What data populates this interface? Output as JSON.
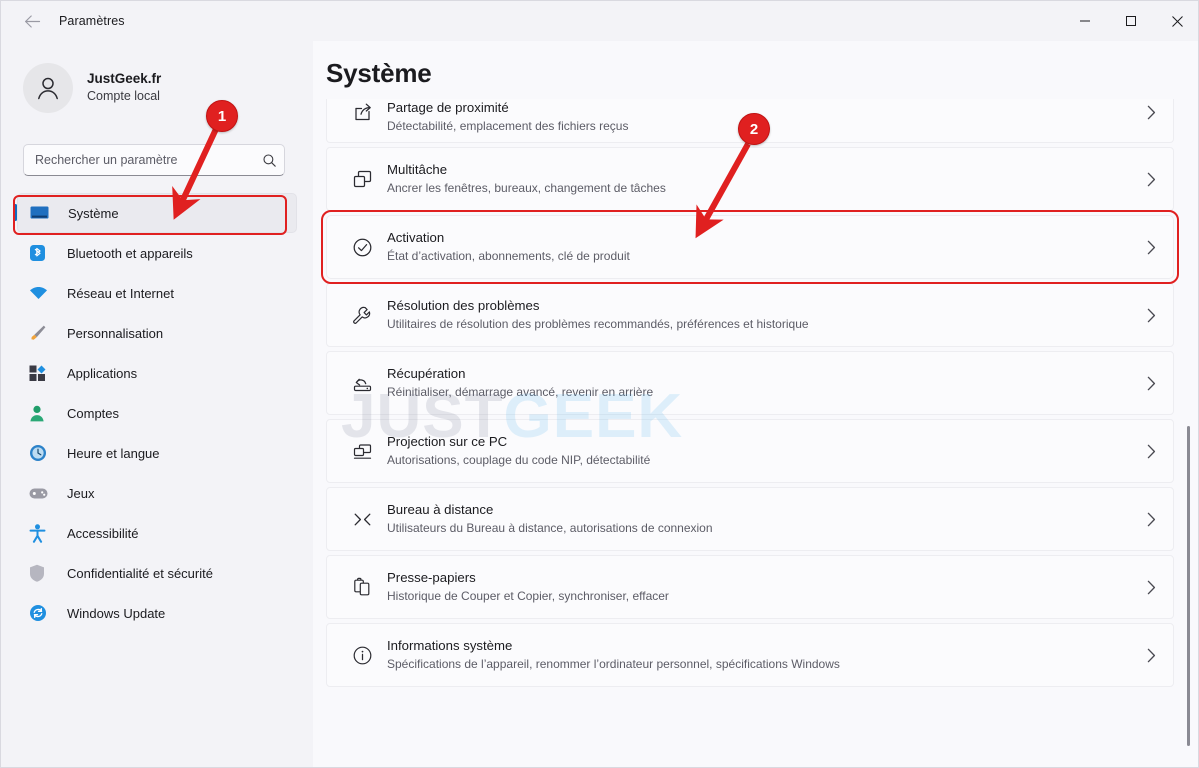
{
  "window": {
    "title": "Paramètres",
    "back_icon": "back-arrow-icon",
    "minimize_label": "—",
    "maximize_label": "□",
    "close_label": "✕"
  },
  "account": {
    "name": "JustGeek.fr",
    "subtitle": "Compte local",
    "avatar_icon": "person-icon"
  },
  "search": {
    "placeholder": "Rechercher un paramètre",
    "value": "",
    "icon": "search-icon"
  },
  "sidebar": {
    "items": [
      {
        "label": "Système",
        "icon": "monitor-icon",
        "selected": true
      },
      {
        "label": "Bluetooth et appareils",
        "icon": "bluetooth-icon",
        "selected": false
      },
      {
        "label": "Réseau et Internet",
        "icon": "wifi-icon",
        "selected": false
      },
      {
        "label": "Personnalisation",
        "icon": "paintbrush-icon",
        "selected": false
      },
      {
        "label": "Applications",
        "icon": "apps-grid-icon",
        "selected": false
      },
      {
        "label": "Comptes",
        "icon": "account-icon",
        "selected": false
      },
      {
        "label": "Heure et langue",
        "icon": "clock-icon",
        "selected": false
      },
      {
        "label": "Jeux",
        "icon": "gamepad-icon",
        "selected": false
      },
      {
        "label": "Accessibilité",
        "icon": "accessibility-icon",
        "selected": false
      },
      {
        "label": "Confidentialité et sécurité",
        "icon": "shield-icon",
        "selected": false
      },
      {
        "label": "Windows Update",
        "icon": "update-icon",
        "selected": false
      }
    ]
  },
  "main": {
    "page_title": "Système",
    "watermark": {
      "part1": "JUST",
      "part2": "GEEK"
    },
    "items": [
      {
        "title": "Partage de proximité",
        "subtitle": "Détectabilité, emplacement des fichiers reçus",
        "icon": "share-icon",
        "chevron": "chevron-right-icon",
        "highlighted": false
      },
      {
        "title": "Multitâche",
        "subtitle": "Ancrer les fenêtres, bureaux, changement de tâches",
        "icon": "multitask-windows-icon",
        "chevron": "chevron-right-icon",
        "highlighted": false
      },
      {
        "title": "Activation",
        "subtitle": "État d’activation, abonnements, clé de produit",
        "icon": "check-circle-icon",
        "chevron": "chevron-right-icon",
        "highlighted": true
      },
      {
        "title": "Résolution des problèmes",
        "subtitle": "Utilitaires de résolution des problèmes recommandés, préférences et historique",
        "icon": "wrench-icon",
        "chevron": "chevron-right-icon",
        "highlighted": false
      },
      {
        "title": "Récupération",
        "subtitle": "Réinitialiser, démarrage avancé, revenir en arrière",
        "icon": "recovery-icon",
        "chevron": "chevron-right-icon",
        "highlighted": false
      },
      {
        "title": "Projection sur ce PC",
        "subtitle": "Autorisations, couplage du code NIP, détectabilité",
        "icon": "project-screen-icon",
        "chevron": "chevron-right-icon",
        "highlighted": false
      },
      {
        "title": "Bureau à distance",
        "subtitle": "Utilisateurs du Bureau à distance, autorisations de connexion",
        "icon": "remote-desktop-icon",
        "chevron": "chevron-right-icon",
        "highlighted": false
      },
      {
        "title": "Presse-papiers",
        "subtitle": "Historique de Couper et Copier, synchroniser, effacer",
        "icon": "clipboard-icon",
        "chevron": "chevron-right-icon",
        "highlighted": false
      },
      {
        "title": "Informations système",
        "subtitle": "Spécifications de l’appareil, renommer l’ordinateur personnel, spécifications Windows",
        "icon": "info-circle-icon",
        "chevron": "chevron-right-icon",
        "highlighted": false
      }
    ]
  },
  "annotations": {
    "badges": [
      {
        "label": "1",
        "target": "sidebar-item-systeme"
      },
      {
        "label": "2",
        "target": "settings-card-activation"
      }
    ],
    "accent_color": "#e02020"
  }
}
